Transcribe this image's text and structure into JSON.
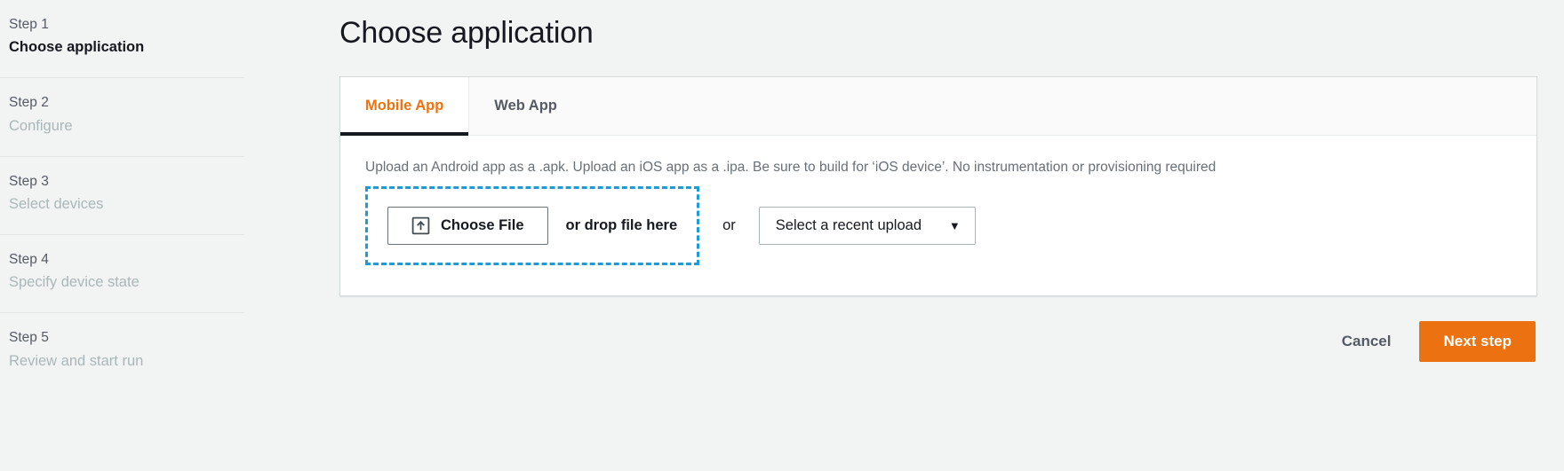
{
  "sidebar": {
    "steps": [
      {
        "num": "Step 1",
        "title": "Choose application",
        "active": true
      },
      {
        "num": "Step 2",
        "title": "Configure",
        "active": false
      },
      {
        "num": "Step 3",
        "title": "Select devices",
        "active": false
      },
      {
        "num": "Step 4",
        "title": "Specify device state",
        "active": false
      },
      {
        "num": "Step 5",
        "title": "Review and start run",
        "active": false
      }
    ]
  },
  "main": {
    "page_title": "Choose application",
    "tabs": [
      {
        "label": "Mobile App",
        "active": true
      },
      {
        "label": "Web App",
        "active": false
      }
    ],
    "hint": "Upload an Android app as a .apk. Upload an iOS app as a .ipa. Be sure to build for ‘iOS device’. No instrumentation or provisioning required",
    "upload": {
      "choose_file_label": "Choose File",
      "choose_file_icon": "upload-icon",
      "drop_text": "or drop file here",
      "or_label": "or",
      "recent_upload_value": "Select a recent upload",
      "recent_upload_caret": "▼"
    },
    "actions": {
      "cancel_label": "Cancel",
      "next_label": "Next step"
    }
  },
  "colors": {
    "accent_orange": "#ec7211",
    "dropzone_blue": "#1e9ad6",
    "tab_underline": "#16191f",
    "muted_text": "#aab7b8",
    "body_bg": "#f2f3f3"
  }
}
